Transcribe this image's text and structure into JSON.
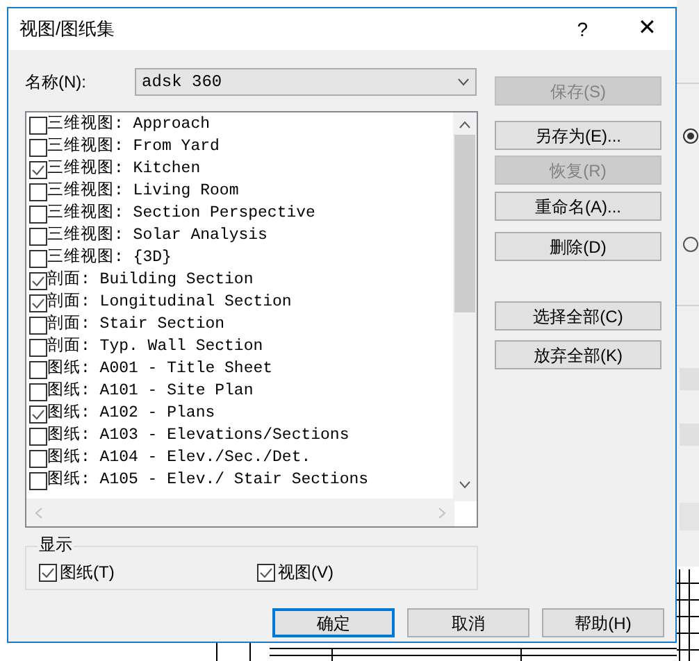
{
  "window": {
    "title": "视图/图纸集",
    "help": "?",
    "close": "✕"
  },
  "name_field": {
    "label": "名称(N):",
    "value": "adsk 360"
  },
  "items": [
    {
      "label": "三维视图: Approach",
      "checked": false
    },
    {
      "label": "三维视图: From Yard",
      "checked": false
    },
    {
      "label": "三维视图: Kitchen",
      "checked": true
    },
    {
      "label": "三维视图: Living Room",
      "checked": false
    },
    {
      "label": "三维视图: Section Perspective",
      "checked": false
    },
    {
      "label": "三维视图: Solar Analysis",
      "checked": false
    },
    {
      "label": "三维视图: {3D}",
      "checked": false
    },
    {
      "label": "剖面: Building Section",
      "checked": true
    },
    {
      "label": "剖面: Longitudinal Section",
      "checked": true
    },
    {
      "label": "剖面: Stair Section",
      "checked": false
    },
    {
      "label": "剖面: Typ. Wall Section",
      "checked": false
    },
    {
      "label": "图纸: A001 - Title Sheet",
      "checked": false
    },
    {
      "label": "图纸: A101 - Site Plan",
      "checked": false
    },
    {
      "label": "图纸: A102 - Plans",
      "checked": true
    },
    {
      "label": "图纸: A103 - Elevations/Sections",
      "checked": false
    },
    {
      "label": "图纸: A104 - Elev./Sec./Det.",
      "checked": false
    },
    {
      "label": "图纸: A105 - Elev./ Stair Sections",
      "checked": false
    }
  ],
  "side_buttons": [
    {
      "label": "保存(S)",
      "disabled": true
    },
    {
      "label": "另存为(E)...",
      "disabled": false
    },
    {
      "label": "恢复(R)",
      "disabled": true
    },
    {
      "label": "重命名(A)...",
      "disabled": false
    },
    {
      "label": "删除(D)",
      "disabled": false
    },
    {
      "label": "选择全部(C)",
      "disabled": false
    },
    {
      "label": "放弃全部(K)",
      "disabled": false
    }
  ],
  "display": {
    "title": "显示",
    "options": [
      {
        "label": "图纸(T)",
        "checked": true
      },
      {
        "label": "视图(V)",
        "checked": true
      }
    ]
  },
  "buttons": [
    {
      "label": "确定",
      "selected": true
    },
    {
      "label": "取消",
      "selected": false
    },
    {
      "label": "帮助(H)",
      "selected": false
    }
  ]
}
